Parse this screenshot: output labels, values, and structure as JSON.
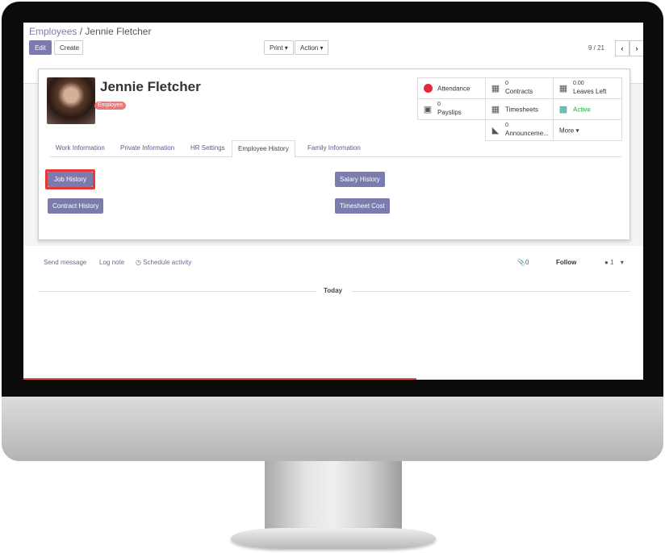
{
  "breadcrumb": {
    "parent": "Employees",
    "separator": " / ",
    "current": "Jennie Fletcher"
  },
  "toolbar": {
    "edit": "Edit",
    "create": "Create",
    "print": "Print",
    "action": "Action",
    "caret": "▾"
  },
  "pager": {
    "value": "9 / 21",
    "prev": "‹",
    "next": "›"
  },
  "employee": {
    "name": "Jennie Fletcher",
    "tag": "Employee"
  },
  "stats": {
    "attendance": {
      "label": "Attendance",
      "status_color": "#e0293a"
    },
    "contracts": {
      "value": "0",
      "label": "Contracts"
    },
    "leaves": {
      "value": "0.00",
      "label": "Leaves Left"
    },
    "payslips": {
      "value": "0",
      "label": "Payslips"
    },
    "timesheets": {
      "label": "Timesheets"
    },
    "active": {
      "label": "Active",
      "color": "#28a745"
    },
    "announcements": {
      "value": "0",
      "label": "Announceme..."
    },
    "more": {
      "label": "More ▾"
    }
  },
  "tabs": [
    "Work Information",
    "Private Information",
    "HR Settings",
    "Employee History",
    "Family Information"
  ],
  "active_tab": "Employee History",
  "history_buttons": {
    "job": "Job History",
    "contract": "Contract History",
    "salary": "Salary History",
    "timesheet": "Timesheet Cost"
  },
  "chatter": {
    "send": "Send message",
    "log": "Log note",
    "schedule": "Schedule activity",
    "attachments": "0",
    "follow": "Follow",
    "followers": "1",
    "today": "Today"
  },
  "colors": {
    "accent": "#7c7bad",
    "tag": "#e8797a",
    "highlight": "#e53935"
  }
}
